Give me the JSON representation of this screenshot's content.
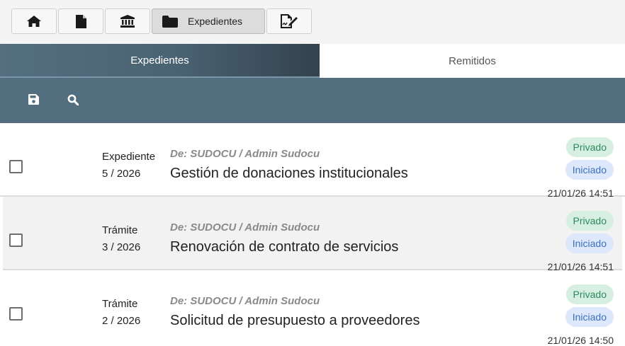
{
  "nav": {
    "buttons": [
      {
        "icon": "home-icon"
      },
      {
        "icon": "document-icon"
      },
      {
        "icon": "institution-icon"
      },
      {
        "icon": "folder-icon",
        "label": "Expedientes",
        "active": true
      },
      {
        "icon": "signature-icon"
      }
    ]
  },
  "tabs": [
    {
      "label": "Expedientes",
      "active": true
    },
    {
      "label": "Remitidos",
      "active": false
    }
  ],
  "toolbar": {
    "icons": [
      "save-icon",
      "search-icon"
    ]
  },
  "colors": {
    "header": "#536e7f",
    "green_badge": "#d6efe2",
    "blue_badge": "#dde9fb"
  },
  "rows": [
    {
      "type": "Expediente",
      "number": "5 / 2026",
      "from": "De: SUDOCU / Admin Sudocu",
      "title": "Gestión de donaciones institucionales",
      "badge_privacy": "Privado",
      "badge_status": "Iniciado",
      "date": "21/01/26 14:51"
    },
    {
      "type": "Trámite",
      "number": "3 / 2026",
      "from": "De: SUDOCU / Admin Sudocu",
      "title": "Renovación de contrato de servicios",
      "badge_privacy": "Privado",
      "badge_status": "Iniciado",
      "date": "21/01/26 14:51"
    },
    {
      "type": "Trámite",
      "number": "2 / 2026",
      "from": "De: SUDOCU / Admin Sudocu",
      "title": "Solicitud de presupuesto a proveedores",
      "badge_privacy": "Privado",
      "badge_status": "Iniciado",
      "date": "21/01/26 14:50"
    }
  ]
}
